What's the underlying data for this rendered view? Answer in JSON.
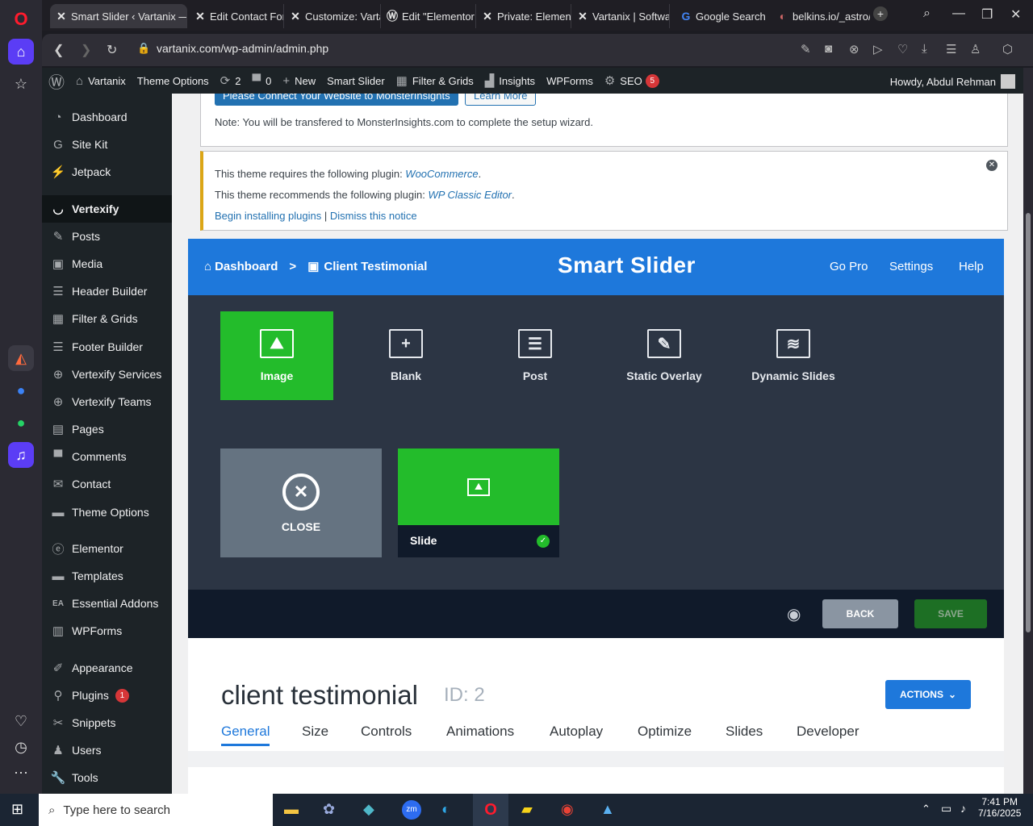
{
  "browser": {
    "tabs": [
      {
        "label": "Smart Slider ‹ Vartanix —",
        "icon": "x-icon"
      },
      {
        "label": "Edit Contact For",
        "icon": "x-icon"
      },
      {
        "label": "Customize: Varta",
        "icon": "x-icon"
      },
      {
        "label": "Edit \"Elementor",
        "icon": "wp-icon"
      },
      {
        "label": "Private: Element",
        "icon": "x-icon"
      },
      {
        "label": "Vartanix | Softwa",
        "icon": "x-icon"
      },
      {
        "label": "Google Search",
        "icon": "google-icon"
      },
      {
        "label": "belkins.io/_astro/",
        "icon": "site-icon"
      }
    ],
    "url": "vartanix.com/wp-admin/admin.php"
  },
  "adminbar": {
    "site": "Vartanix",
    "theme_options": "Theme Options",
    "updates": "2",
    "comments": "0",
    "new": "New",
    "smart_slider": "Smart Slider",
    "filter_grids": "Filter & Grids",
    "insights": "Insights",
    "wpforms": "WPForms",
    "seo": "SEO",
    "seo_badge": "5",
    "howdy": "Howdy, Abdul Rehman"
  },
  "sidebar": {
    "items": [
      {
        "label": "Dashboard",
        "icon": "dashboard-icon"
      },
      {
        "label": "Site Kit",
        "icon": "google-g-icon"
      },
      {
        "label": "Jetpack",
        "icon": "jetpack-icon"
      },
      {
        "label": "Vertexify",
        "icon": "smile-icon"
      },
      {
        "label": "Posts",
        "icon": "pin-icon"
      },
      {
        "label": "Media",
        "icon": "media-icon"
      },
      {
        "label": "Header Builder",
        "icon": "list-icon"
      },
      {
        "label": "Filter & Grids",
        "icon": "grid-icon"
      },
      {
        "label": "Footer Builder",
        "icon": "list-icon"
      },
      {
        "label": "Vertexify Services",
        "icon": "plus-circle-icon"
      },
      {
        "label": "Vertexify Teams",
        "icon": "plus-circle-icon"
      },
      {
        "label": "Pages",
        "icon": "pages-icon"
      },
      {
        "label": "Comments",
        "icon": "comment-icon"
      },
      {
        "label": "Contact",
        "icon": "mail-icon"
      },
      {
        "label": "Theme Options",
        "icon": "folder-icon"
      },
      {
        "label": "Elementor",
        "icon": "elementor-icon"
      },
      {
        "label": "Templates",
        "icon": "folder-icon"
      },
      {
        "label": "Essential Addons",
        "icon": "ea-icon"
      },
      {
        "label": "WPForms",
        "icon": "form-icon"
      },
      {
        "label": "Appearance",
        "icon": "brush-icon"
      },
      {
        "label": "Plugins",
        "icon": "plugin-icon",
        "badge": "1"
      },
      {
        "label": "Snippets",
        "icon": "scissors-icon"
      },
      {
        "label": "Users",
        "icon": "user-icon"
      },
      {
        "label": "Tools",
        "icon": "wrench-icon"
      }
    ]
  },
  "notices": {
    "connect_btn": "Please Connect Your Website to MonsterInsights",
    "learn_more": "Learn More",
    "note": "Note: You will be transfered to MonsterInsights.com to complete the setup wizard.",
    "requires": "This theme requires the following plugin: ",
    "requires_plugin": "WooCommerce",
    "recommends": "This theme recommends the following plugin: ",
    "recommends_plugin": "WP Classic Editor",
    "begin": "Begin installing plugins",
    "sep": "|",
    "dismiss": "Dismiss this notice",
    "period": "."
  },
  "smart_slider": {
    "crumb_dashboard": "Dashboard",
    "crumb_sep": ">",
    "crumb_current": "Client Testimonial",
    "logo": "Smart Slider",
    "go_pro": "Go Pro",
    "settings": "Settings",
    "help": "Help",
    "types": [
      "Image",
      "Blank",
      "Post",
      "Static Overlay",
      "Dynamic Slides"
    ],
    "close": "CLOSE",
    "slide": "Slide",
    "back": "BACK",
    "save": "SAVE"
  },
  "slider": {
    "title": "client testimonial",
    "id": "ID: 2",
    "actions": "ACTIONS",
    "tabs": [
      "General",
      "Size",
      "Controls",
      "Animations",
      "Autoplay",
      "Optimize",
      "Slides",
      "Developer"
    ]
  },
  "taskbar": {
    "search": "Type here to search",
    "time": "7:41 PM",
    "date": "7/16/2025"
  },
  "colors": {
    "wp_dark": "#1d2327",
    "ss_blue": "#1e78db",
    "ss_green": "#23bc2b",
    "wp_blue": "#2271b1"
  }
}
